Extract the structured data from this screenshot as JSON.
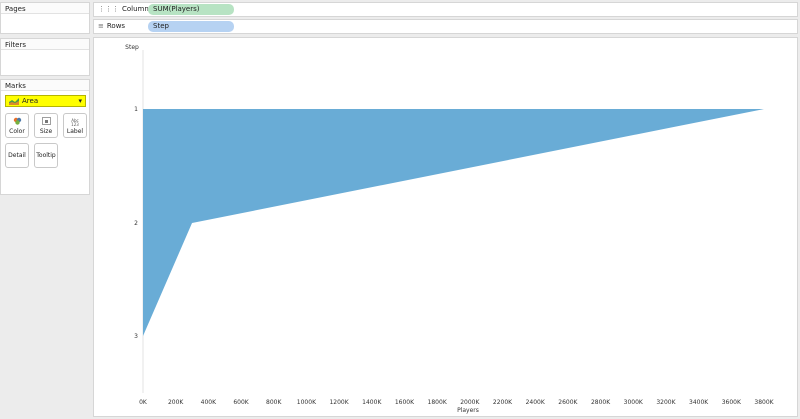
{
  "pages": {
    "title": "Pages"
  },
  "filters": {
    "title": "Filters"
  },
  "marks": {
    "title": "Marks",
    "type": "Area",
    "buttons": {
      "color": "Color",
      "size": "Size",
      "label": "Label",
      "detail": "Detail",
      "tooltip": "Tooltip"
    },
    "label_icon_text": "Abc\n123"
  },
  "shelves": {
    "columns": {
      "label": "Columns",
      "pill": "SUM(Players)"
    },
    "rows": {
      "label": "Rows",
      "pill": "Step"
    }
  },
  "colors": {
    "area": "#69acd6",
    "marks_highlight": "#ffff00"
  },
  "chart_data": {
    "type": "area",
    "title": "",
    "xlabel": "Players",
    "ylabel": "Step",
    "categories": [
      "1",
      "2",
      "3"
    ],
    "series": [
      {
        "values": [
          3800000,
          300000,
          0
        ]
      }
    ],
    "xlim": [
      0,
      3800000
    ],
    "xticks": [
      "0K",
      "200K",
      "400K",
      "600K",
      "800K",
      "1000K",
      "1200K",
      "1400K",
      "1600K",
      "1800K",
      "2000K",
      "2200K",
      "2400K",
      "2600K",
      "2800K",
      "3000K",
      "3200K",
      "3400K",
      "3600K",
      "3800K"
    ]
  }
}
